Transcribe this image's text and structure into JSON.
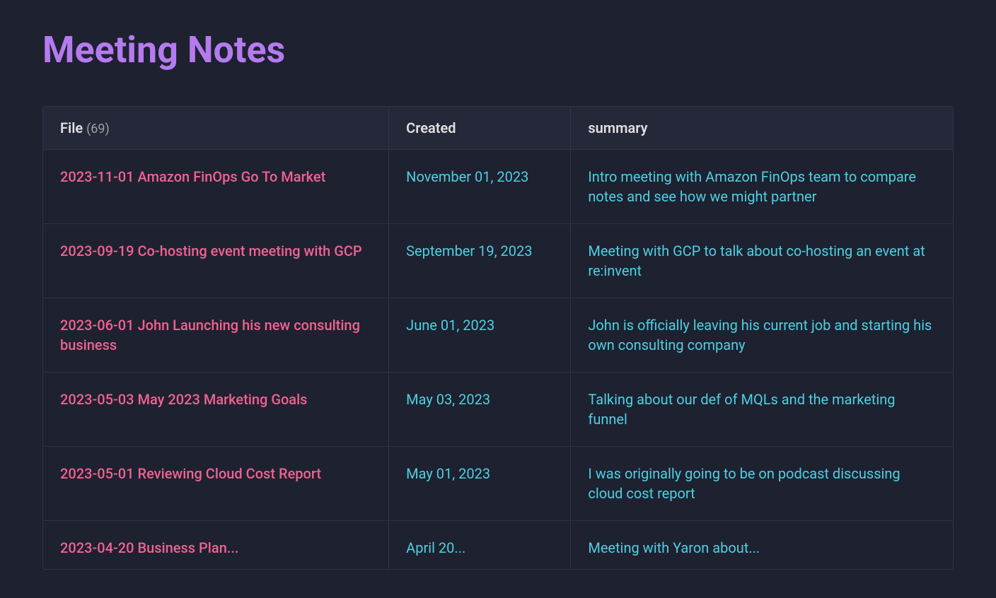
{
  "page": {
    "title": "Meeting Notes"
  },
  "table": {
    "columns": {
      "file_label": "File",
      "file_count": "(69)",
      "created_label": "Created",
      "summary_label": "summary"
    },
    "rows": [
      {
        "file": "2023-11-01 Amazon FinOps Go To Market",
        "created": "November 01, 2023",
        "summary": "Intro meeting with Amazon FinOps team to compare notes and see how we might partner"
      },
      {
        "file": "2023-09-19 Co-hosting event meeting with GCP",
        "created": "September 19, 2023",
        "summary": "Meeting with GCP to talk about co-hosting an event at re:invent"
      },
      {
        "file": "2023-06-01 John Launching his new consulting business",
        "created": "June 01, 2023",
        "summary": "John is officially leaving his current job and starting his own consulting company"
      },
      {
        "file": "2023-05-03 May 2023 Marketing Goals",
        "created": "May 03, 2023",
        "summary": "Talking about our def of MQLs and the marketing funnel"
      },
      {
        "file": "2023-05-01 Reviewing Cloud Cost Report",
        "created": "May 01, 2023",
        "summary": "I was originally going to be on podcast discussing cloud cost report"
      },
      {
        "file": "2023-04-20 Business Plan...",
        "created": "April 20...",
        "summary": "Meeting with Yaron about..."
      }
    ]
  }
}
